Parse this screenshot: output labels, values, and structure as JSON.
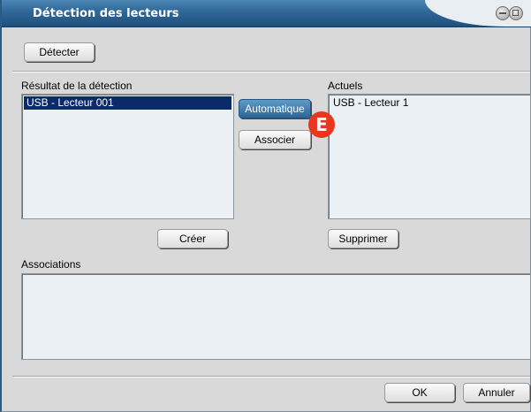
{
  "window": {
    "title": "Détection des lecteurs"
  },
  "toolbar": {
    "detect_label": "Détecter"
  },
  "detection": {
    "heading": "Résultat de la détection",
    "items": [
      "USB - Lecteur 001"
    ],
    "create_label": "Créer"
  },
  "actions": {
    "automatic_label": "Automatique",
    "associate_label": "Associer"
  },
  "current": {
    "heading": "Actuels",
    "items": [
      "USB - Lecteur 1"
    ],
    "delete_label": "Supprimer"
  },
  "associations": {
    "heading": "Associations"
  },
  "footer": {
    "ok_label": "OK",
    "cancel_label": "Annuler"
  },
  "annotation": {
    "badge_letter": "E"
  },
  "colors": {
    "title_bar": "#2f6797",
    "selection": "#0a2a6b",
    "badge": "#e8361f"
  },
  "icons": [
    "minimize-icon",
    "maximize-icon"
  ]
}
